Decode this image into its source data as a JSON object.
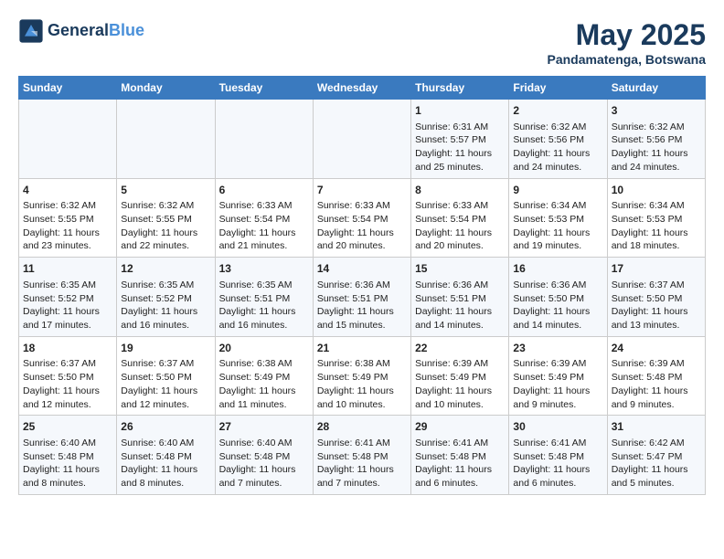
{
  "header": {
    "logo_line1": "General",
    "logo_line2": "Blue",
    "month": "May 2025",
    "location": "Pandamatenga, Botswana"
  },
  "days_of_week": [
    "Sunday",
    "Monday",
    "Tuesday",
    "Wednesday",
    "Thursday",
    "Friday",
    "Saturday"
  ],
  "weeks": [
    [
      {
        "day": "",
        "info": ""
      },
      {
        "day": "",
        "info": ""
      },
      {
        "day": "",
        "info": ""
      },
      {
        "day": "",
        "info": ""
      },
      {
        "day": "1",
        "info": "Sunrise: 6:31 AM\nSunset: 5:57 PM\nDaylight: 11 hours and 25 minutes."
      },
      {
        "day": "2",
        "info": "Sunrise: 6:32 AM\nSunset: 5:56 PM\nDaylight: 11 hours and 24 minutes."
      },
      {
        "day": "3",
        "info": "Sunrise: 6:32 AM\nSunset: 5:56 PM\nDaylight: 11 hours and 24 minutes."
      }
    ],
    [
      {
        "day": "4",
        "info": "Sunrise: 6:32 AM\nSunset: 5:55 PM\nDaylight: 11 hours and 23 minutes."
      },
      {
        "day": "5",
        "info": "Sunrise: 6:32 AM\nSunset: 5:55 PM\nDaylight: 11 hours and 22 minutes."
      },
      {
        "day": "6",
        "info": "Sunrise: 6:33 AM\nSunset: 5:54 PM\nDaylight: 11 hours and 21 minutes."
      },
      {
        "day": "7",
        "info": "Sunrise: 6:33 AM\nSunset: 5:54 PM\nDaylight: 11 hours and 20 minutes."
      },
      {
        "day": "8",
        "info": "Sunrise: 6:33 AM\nSunset: 5:54 PM\nDaylight: 11 hours and 20 minutes."
      },
      {
        "day": "9",
        "info": "Sunrise: 6:34 AM\nSunset: 5:53 PM\nDaylight: 11 hours and 19 minutes."
      },
      {
        "day": "10",
        "info": "Sunrise: 6:34 AM\nSunset: 5:53 PM\nDaylight: 11 hours and 18 minutes."
      }
    ],
    [
      {
        "day": "11",
        "info": "Sunrise: 6:35 AM\nSunset: 5:52 PM\nDaylight: 11 hours and 17 minutes."
      },
      {
        "day": "12",
        "info": "Sunrise: 6:35 AM\nSunset: 5:52 PM\nDaylight: 11 hours and 16 minutes."
      },
      {
        "day": "13",
        "info": "Sunrise: 6:35 AM\nSunset: 5:51 PM\nDaylight: 11 hours and 16 minutes."
      },
      {
        "day": "14",
        "info": "Sunrise: 6:36 AM\nSunset: 5:51 PM\nDaylight: 11 hours and 15 minutes."
      },
      {
        "day": "15",
        "info": "Sunrise: 6:36 AM\nSunset: 5:51 PM\nDaylight: 11 hours and 14 minutes."
      },
      {
        "day": "16",
        "info": "Sunrise: 6:36 AM\nSunset: 5:50 PM\nDaylight: 11 hours and 14 minutes."
      },
      {
        "day": "17",
        "info": "Sunrise: 6:37 AM\nSunset: 5:50 PM\nDaylight: 11 hours and 13 minutes."
      }
    ],
    [
      {
        "day": "18",
        "info": "Sunrise: 6:37 AM\nSunset: 5:50 PM\nDaylight: 11 hours and 12 minutes."
      },
      {
        "day": "19",
        "info": "Sunrise: 6:37 AM\nSunset: 5:50 PM\nDaylight: 11 hours and 12 minutes."
      },
      {
        "day": "20",
        "info": "Sunrise: 6:38 AM\nSunset: 5:49 PM\nDaylight: 11 hours and 11 minutes."
      },
      {
        "day": "21",
        "info": "Sunrise: 6:38 AM\nSunset: 5:49 PM\nDaylight: 11 hours and 10 minutes."
      },
      {
        "day": "22",
        "info": "Sunrise: 6:39 AM\nSunset: 5:49 PM\nDaylight: 11 hours and 10 minutes."
      },
      {
        "day": "23",
        "info": "Sunrise: 6:39 AM\nSunset: 5:49 PM\nDaylight: 11 hours and 9 minutes."
      },
      {
        "day": "24",
        "info": "Sunrise: 6:39 AM\nSunset: 5:48 PM\nDaylight: 11 hours and 9 minutes."
      }
    ],
    [
      {
        "day": "25",
        "info": "Sunrise: 6:40 AM\nSunset: 5:48 PM\nDaylight: 11 hours and 8 minutes."
      },
      {
        "day": "26",
        "info": "Sunrise: 6:40 AM\nSunset: 5:48 PM\nDaylight: 11 hours and 8 minutes."
      },
      {
        "day": "27",
        "info": "Sunrise: 6:40 AM\nSunset: 5:48 PM\nDaylight: 11 hours and 7 minutes."
      },
      {
        "day": "28",
        "info": "Sunrise: 6:41 AM\nSunset: 5:48 PM\nDaylight: 11 hours and 7 minutes."
      },
      {
        "day": "29",
        "info": "Sunrise: 6:41 AM\nSunset: 5:48 PM\nDaylight: 11 hours and 6 minutes."
      },
      {
        "day": "30",
        "info": "Sunrise: 6:41 AM\nSunset: 5:48 PM\nDaylight: 11 hours and 6 minutes."
      },
      {
        "day": "31",
        "info": "Sunrise: 6:42 AM\nSunset: 5:47 PM\nDaylight: 11 hours and 5 minutes."
      }
    ]
  ]
}
